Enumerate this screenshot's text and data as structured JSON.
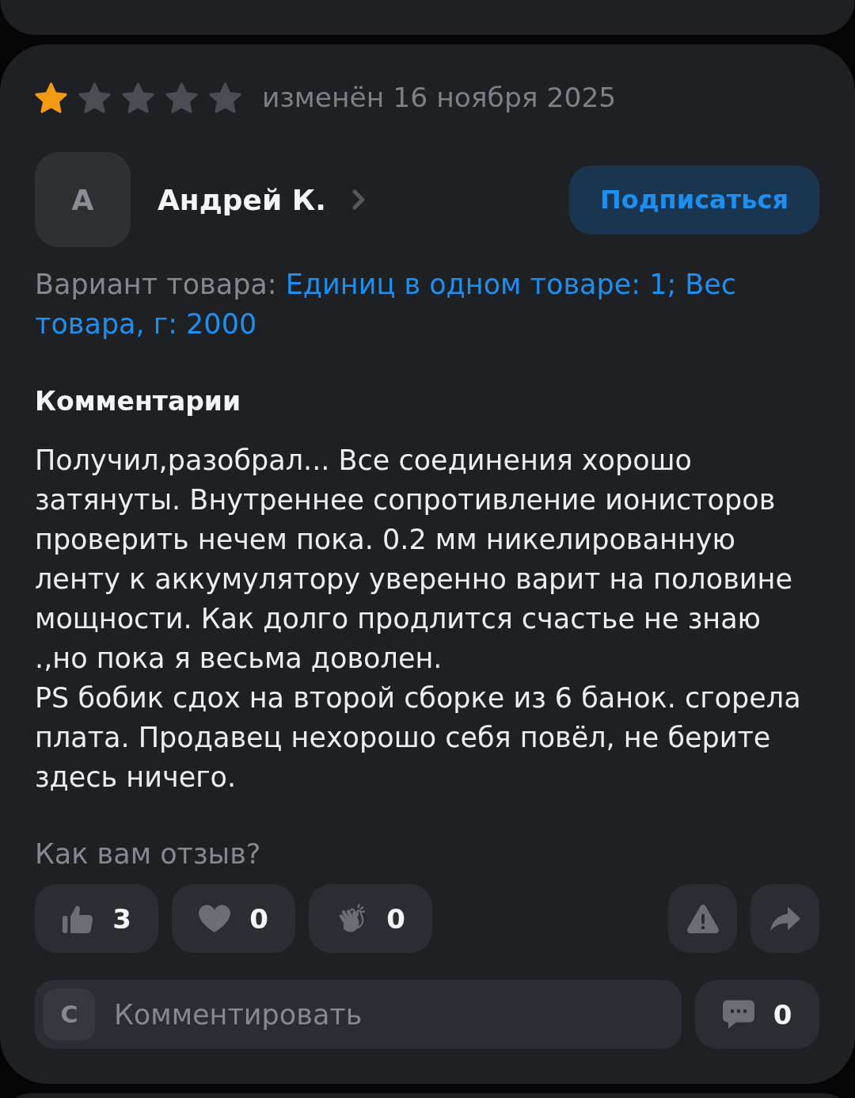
{
  "review": {
    "stars": 1,
    "date": "изменён 16 ноября 2025",
    "author": {
      "initial": "А",
      "name": "Андрей К."
    },
    "subscribe_button": "Подписаться",
    "variant": {
      "label": "Вариант товара:",
      "value": "Единиц в одном товаре: 1; Вес товара, г: 2000"
    },
    "comments_heading": "Комментарии",
    "text": "Получил,разобрал... Все соединения хорошо затянуты. Внутреннее сопротивление ионисторов проверить нечем пока. 0.2 мм никелированную ленту к аккумулятору уверенно варит на половине мощности. Как долго продлится счастье не знаю .,но пока я весьма доволен.\nPS бобик сдох на второй сборке из 6 банок. сгорела плата. Продавец нехорошо себя повёл, не берите здесь ничего.",
    "feedback_prompt": "Как вам отзыв?",
    "reactions": [
      {
        "kind": "like",
        "count": "3"
      },
      {
        "kind": "heart",
        "count": "0"
      },
      {
        "kind": "clap",
        "count": "0"
      }
    ],
    "actions": [
      {
        "kind": "report"
      },
      {
        "kind": "share"
      }
    ],
    "comment_box": {
      "initial": "С",
      "placeholder": "Комментировать"
    },
    "comments_button": {
      "count": "0"
    }
  }
}
